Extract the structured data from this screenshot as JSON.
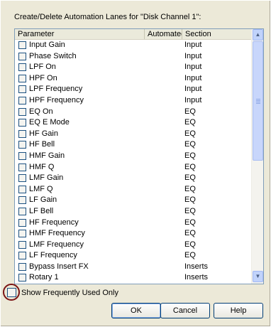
{
  "dialog": {
    "caption": "Create/Delete Automation Lanes for \"Disk Channel 1\":"
  },
  "list": {
    "headers": {
      "parameter": "Parameter",
      "automated": "Automated",
      "section": "Section"
    },
    "rows": [
      {
        "parameter": "Input Gain",
        "section": "Input"
      },
      {
        "parameter": "Phase Switch",
        "section": "Input"
      },
      {
        "parameter": "LPF On",
        "section": "Input"
      },
      {
        "parameter": "HPF On",
        "section": "Input"
      },
      {
        "parameter": "LPF Frequency",
        "section": "Input"
      },
      {
        "parameter": "HPF Frequency",
        "section": "Input"
      },
      {
        "parameter": "EQ On",
        "section": "EQ"
      },
      {
        "parameter": "EQ E Mode",
        "section": "EQ"
      },
      {
        "parameter": "HF Gain",
        "section": "EQ"
      },
      {
        "parameter": "HF Bell",
        "section": "EQ"
      },
      {
        "parameter": "HMF Gain",
        "section": "EQ"
      },
      {
        "parameter": "HMF Q",
        "section": "EQ"
      },
      {
        "parameter": "LMF Gain",
        "section": "EQ"
      },
      {
        "parameter": "LMF Q",
        "section": "EQ"
      },
      {
        "parameter": "LF Gain",
        "section": "EQ"
      },
      {
        "parameter": "LF Bell",
        "section": "EQ"
      },
      {
        "parameter": "HF Frequency",
        "section": "EQ"
      },
      {
        "parameter": "HMF Frequency",
        "section": "EQ"
      },
      {
        "parameter": "LMF Frequency",
        "section": "EQ"
      },
      {
        "parameter": "LF Frequency",
        "section": "EQ"
      },
      {
        "parameter": "Bypass Insert FX",
        "section": "Inserts"
      },
      {
        "parameter": "Rotary 1",
        "section": "Inserts"
      }
    ]
  },
  "footer": {
    "show_frequent_label": "Show Frequently Used Only",
    "buttons": {
      "ok": "OK",
      "cancel": "Cancel",
      "help": "Help"
    }
  }
}
